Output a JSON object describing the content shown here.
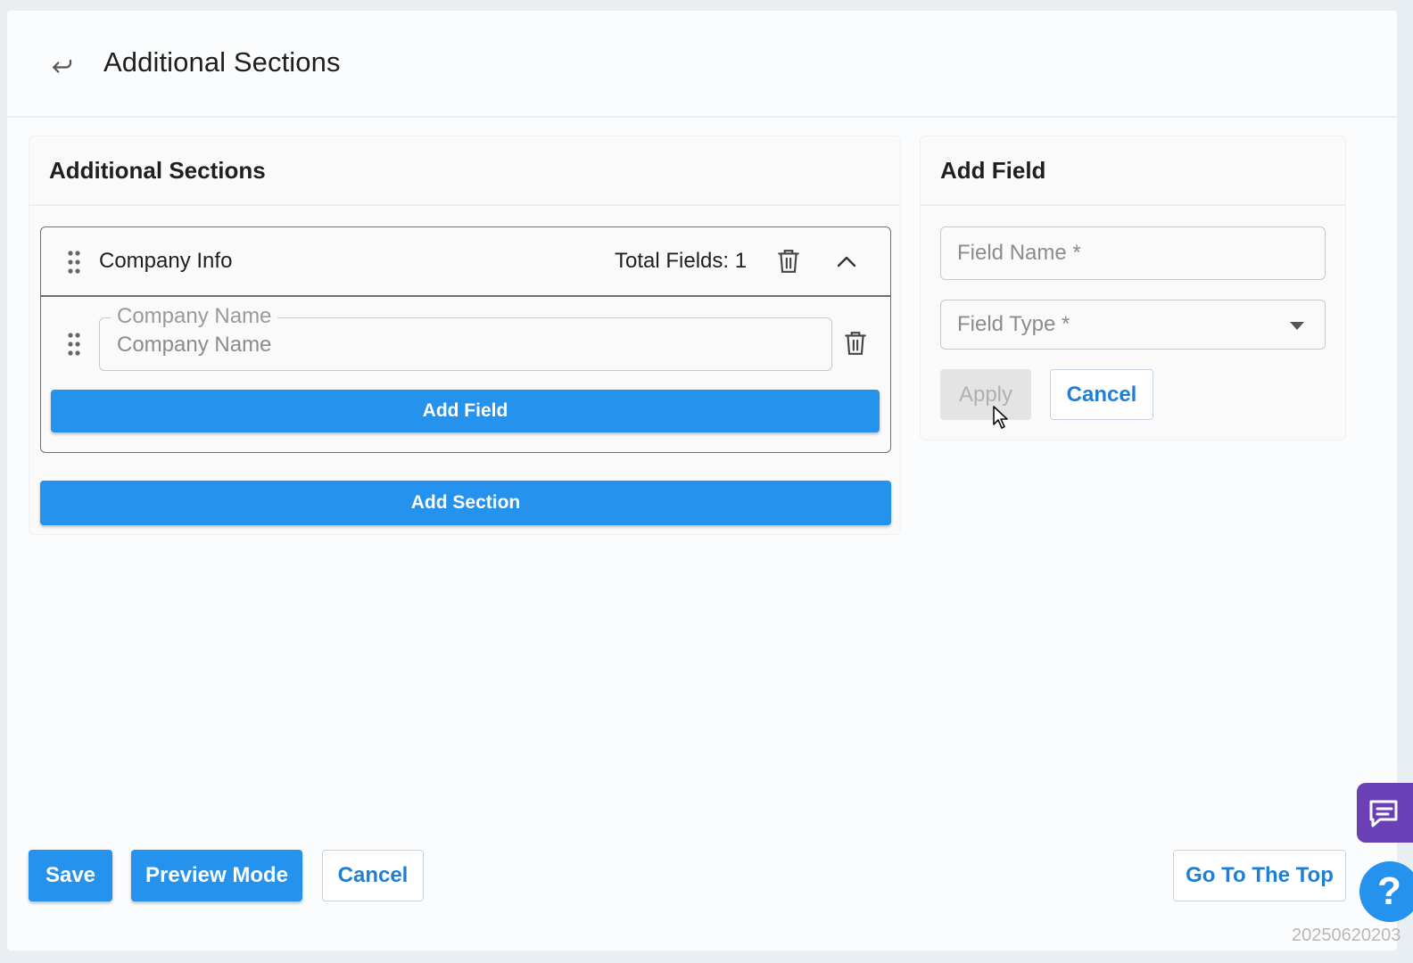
{
  "header": {
    "title": "Additional Sections"
  },
  "left_panel": {
    "title": "Additional Sections",
    "section": {
      "name": "Company Info",
      "total_fields_label": "Total Fields: 1",
      "field": {
        "label": "Company Name",
        "value": "Company Name"
      },
      "add_field_label": "Add Field"
    },
    "add_section_label": "Add Section"
  },
  "right_panel": {
    "title": "Add Field",
    "field_name_placeholder": "Field Name *",
    "field_type_placeholder": "Field Type *",
    "apply_label": "Apply",
    "cancel_label": "Cancel"
  },
  "footer": {
    "save_label": "Save",
    "preview_label": "Preview Mode",
    "cancel_label": "Cancel",
    "top_label": "Go To The Top"
  },
  "widgets": {
    "help_label": "?"
  },
  "timestamp": "20250620203",
  "colors": {
    "primary": "#2592ee",
    "chat": "#6b3fb5",
    "disabled": "#e4e4e4"
  }
}
